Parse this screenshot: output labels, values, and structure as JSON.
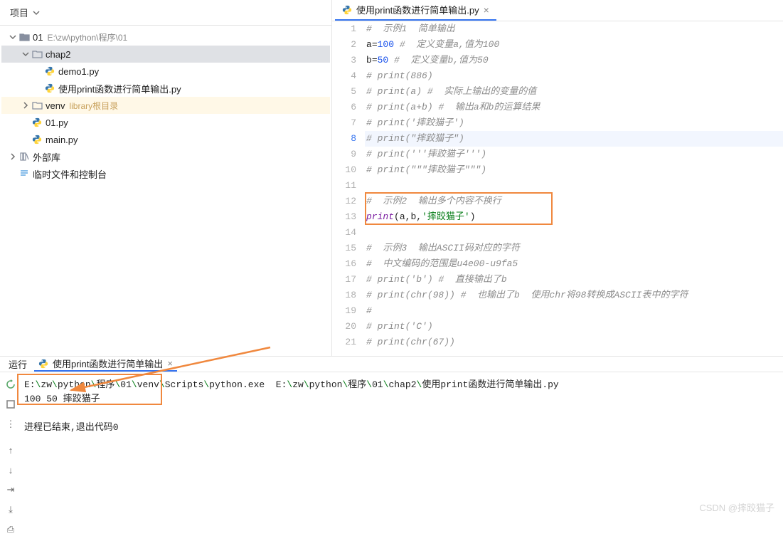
{
  "project": {
    "header_label": "项目",
    "tree": {
      "root": {
        "name": "01",
        "path": "E:\\zw\\python\\程序\\01"
      },
      "chap2": "chap2",
      "demo1": "demo1.py",
      "cur_file": "使用print函数进行简单输出.py",
      "venv": "venv",
      "venv_hint": "library根目录",
      "f01": "01.py",
      "main": "main.py",
      "ext_lib": "外部库",
      "scratch": "临时文件和控制台"
    }
  },
  "tab": {
    "name": "使用print函数进行简单输出.py"
  },
  "code": {
    "lines": [
      {
        "n": 1,
        "type": "comment",
        "text": "#  示例1  简单输出"
      },
      {
        "n": 2,
        "type": "assign",
        "lhs": "a",
        "op": "=",
        "rhs": "100",
        "tail": " #  定义变量a,值为100"
      },
      {
        "n": 3,
        "type": "assign",
        "lhs": "b",
        "op": "=",
        "rhs": "50",
        "tail": " #  定义变量b,值为50"
      },
      {
        "n": 4,
        "type": "comment",
        "text": "# print(886)"
      },
      {
        "n": 5,
        "type": "comment",
        "text": "# print(a) #  实际上输出的变量的值"
      },
      {
        "n": 6,
        "type": "comment",
        "text": "# print(a+b) #  输出a和b的运算结果"
      },
      {
        "n": 7,
        "type": "comment",
        "text": "# print('摔跤猫子')"
      },
      {
        "n": 8,
        "type": "comment",
        "text": "# print(\"摔跤猫子\")",
        "hl": true
      },
      {
        "n": 9,
        "type": "comment",
        "text": "# print('''摔跤猫子''')"
      },
      {
        "n": 10,
        "type": "comment",
        "text": "# print(\"\"\"摔跤猫子\"\"\")"
      },
      {
        "n": 11,
        "type": "blank"
      },
      {
        "n": 12,
        "type": "comment",
        "text": "#  示例2  输出多个内容不换行"
      },
      {
        "n": 13,
        "type": "print",
        "args": [
          "a",
          "b",
          "'摔跤猫子'"
        ]
      },
      {
        "n": 14,
        "type": "blank"
      },
      {
        "n": 15,
        "type": "comment",
        "text": "#  示例3  输出ASCII码对应的字符"
      },
      {
        "n": 16,
        "type": "comment",
        "text": "#  中文编码的范围是u4e00-u9fa5"
      },
      {
        "n": 17,
        "type": "comment",
        "text": "# print('b') #  直接输出了b"
      },
      {
        "n": 18,
        "type": "comment",
        "text": "# print(chr(98)) #  也输出了b  使用chr将98转换成ASCII表中的字符"
      },
      {
        "n": 19,
        "type": "comment",
        "text": "#"
      },
      {
        "n": 20,
        "type": "comment",
        "text": "# print('C')"
      },
      {
        "n": 21,
        "type": "comment",
        "text": "# print(chr(67))"
      }
    ]
  },
  "run": {
    "tab_label": "运行",
    "tab_file": "使用print函数进行简单输出",
    "cmd_parts": [
      "E:",
      "zw",
      "python",
      "程序",
      "01",
      "venv",
      "Scripts",
      "python.exe  E:",
      "zw",
      "python",
      "程序",
      "01",
      "chap2",
      "使用print函数进行简单输出.py"
    ],
    "output": "100 50 摔跤猫子",
    "exit": "进程已结束,退出代码0"
  },
  "watermark": "CSDN @摔跤猫子"
}
